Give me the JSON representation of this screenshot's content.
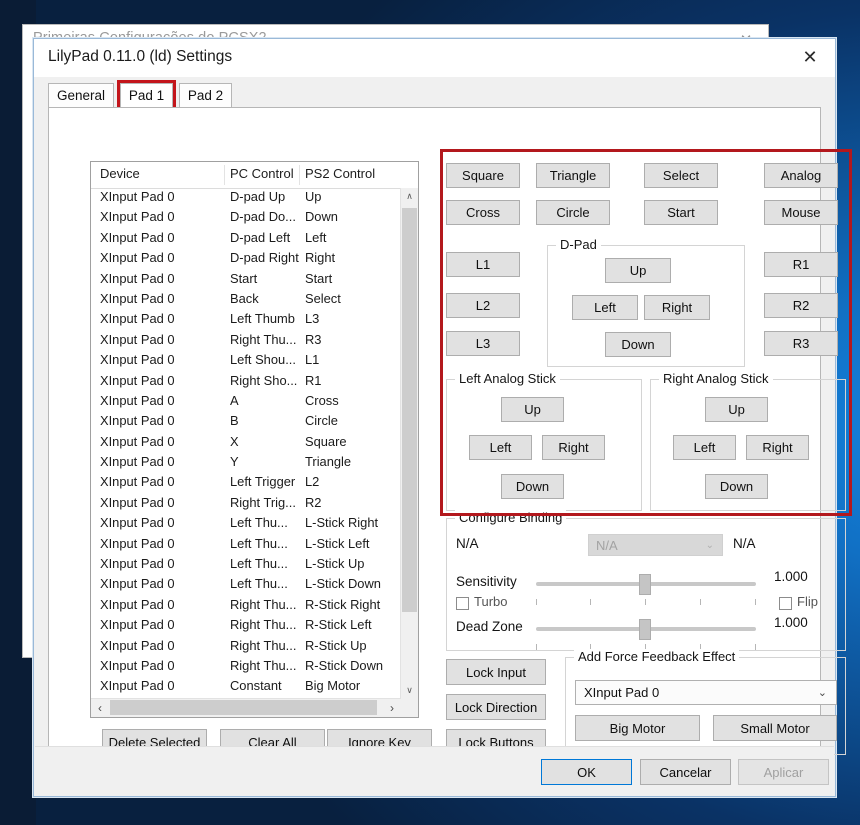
{
  "desktop": {
    "accent_color": "#1384e0",
    "dark_color": "#0a1c35"
  },
  "background_window": {
    "title": "Primeiras Configurações do PCSX2",
    "close_icon": "close-icon",
    "close_glyph": "✕"
  },
  "dialog": {
    "title": "LilyPad 0.11.0 (ld) Settings",
    "close_icon": "close-icon",
    "close_glyph": "✕",
    "highlight_color": "#b3181d"
  },
  "tabs": [
    {
      "label": "General",
      "selected": false
    },
    {
      "label": "Pad 1",
      "selected": true,
      "highlighted": true
    },
    {
      "label": "Pad 2",
      "selected": false
    }
  ],
  "binding_list": {
    "columns": [
      "Device",
      "PC Control",
      "PS2 Control"
    ],
    "rows": [
      [
        "XInput Pad 0",
        "D-pad Up",
        "Up"
      ],
      [
        "XInput Pad 0",
        "D-pad Do...",
        "Down"
      ],
      [
        "XInput Pad 0",
        "D-pad Left",
        "Left"
      ],
      [
        "XInput Pad 0",
        "D-pad Right",
        "Right"
      ],
      [
        "XInput Pad 0",
        "Start",
        "Start"
      ],
      [
        "XInput Pad 0",
        "Back",
        "Select"
      ],
      [
        "XInput Pad 0",
        "Left Thumb",
        "L3"
      ],
      [
        "XInput Pad 0",
        "Right Thu...",
        "R3"
      ],
      [
        "XInput Pad 0",
        "Left Shou...",
        "L1"
      ],
      [
        "XInput Pad 0",
        "Right Sho...",
        "R1"
      ],
      [
        "XInput Pad 0",
        "A",
        "Cross"
      ],
      [
        "XInput Pad 0",
        "B",
        "Circle"
      ],
      [
        "XInput Pad 0",
        "X",
        "Square"
      ],
      [
        "XInput Pad 0",
        "Y",
        "Triangle"
      ],
      [
        "XInput Pad 0",
        "Left Trigger",
        "L2"
      ],
      [
        "XInput Pad 0",
        "Right Trig...",
        "R2"
      ],
      [
        "XInput Pad 0",
        "Left Thu...",
        "L-Stick Right"
      ],
      [
        "XInput Pad 0",
        "Left Thu...",
        "L-Stick Left"
      ],
      [
        "XInput Pad 0",
        "Left Thu...",
        "L-Stick Up"
      ],
      [
        "XInput Pad 0",
        "Left Thu...",
        "L-Stick Down"
      ],
      [
        "XInput Pad 0",
        "Right Thu...",
        "R-Stick Right"
      ],
      [
        "XInput Pad 0",
        "Right Thu...",
        "R-Stick Left"
      ],
      [
        "XInput Pad 0",
        "Right Thu...",
        "R-Stick Up"
      ],
      [
        "XInput Pad 0",
        "Right Thu...",
        "R-Stick Down"
      ],
      [
        "XInput Pad 0",
        "Constant",
        "Big Motor"
      ]
    ],
    "scroll_up_glyph": "∧",
    "scroll_down_glyph": "∨",
    "scroll_left_glyph": "‹",
    "scroll_right_glyph": "›"
  },
  "list_actions": {
    "delete_selected": "Delete Selected",
    "clear_all": "Clear All",
    "ignore_key": "Ignore Key"
  },
  "pad_buttons": {
    "face": [
      "Square",
      "Triangle",
      "Cross",
      "Circle"
    ],
    "square": "Square",
    "triangle": "Triangle",
    "cross": "Cross",
    "circle": "Circle",
    "select": "Select",
    "start": "Start",
    "analog": "Analog",
    "mouse": "Mouse",
    "l1": "L1",
    "l2": "L2",
    "l3": "L3",
    "r1": "R1",
    "r2": "R2",
    "r3": "R3"
  },
  "dpad": {
    "title": "D-Pad",
    "up": "Up",
    "left": "Left",
    "right": "Right",
    "down": "Down"
  },
  "left_stick": {
    "title": "Left Analog Stick",
    "up": "Up",
    "left": "Left",
    "right": "Right",
    "down": "Down"
  },
  "right_stick": {
    "title": "Right Analog Stick",
    "up": "Up",
    "left": "Left",
    "right": "Right",
    "down": "Down"
  },
  "configure_binding": {
    "title": "Configure Binding",
    "left_label": "N/A",
    "combo_value": "N/A",
    "right_label": "N/A",
    "sensitivity_label": "Sensitivity",
    "sensitivity_value": "1.000",
    "turbo_label": "Turbo",
    "flip_label": "Flip",
    "deadzone_label": "Dead Zone",
    "deadzone_value": "1.000"
  },
  "lock_buttons": {
    "lock_input": "Lock Input",
    "lock_direction": "Lock Direction",
    "lock_buttons": "Lock Buttons"
  },
  "force_feedback": {
    "title": "Add Force Feedback Effect",
    "device": "XInput Pad 0",
    "big_motor": "Big Motor",
    "small_motor": "Small Motor",
    "dropdown_glyph": "∨"
  },
  "footer": {
    "ok": "OK",
    "cancel": "Cancelar",
    "apply": "Aplicar",
    "apply_disabled": true
  }
}
